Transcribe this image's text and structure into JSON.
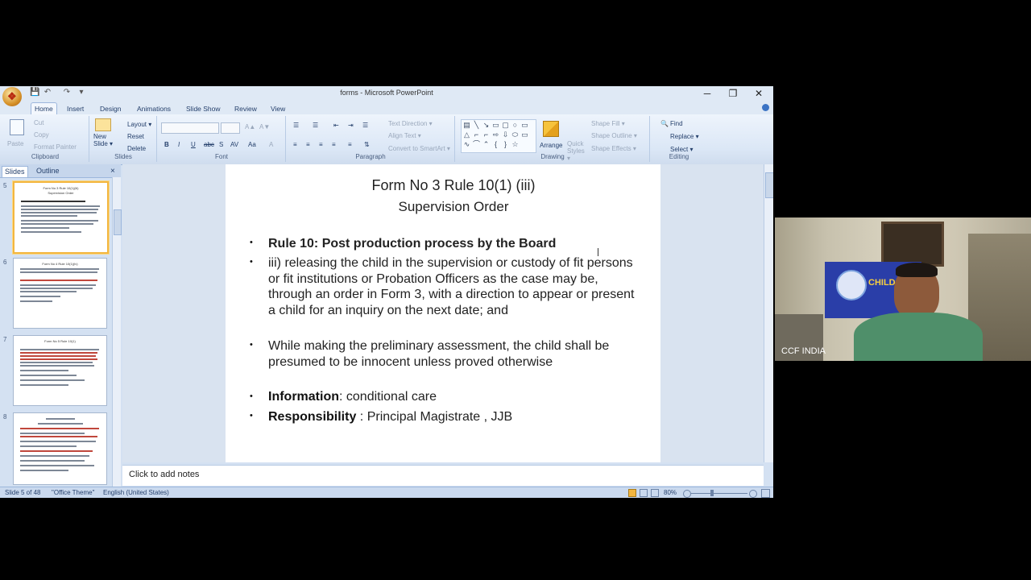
{
  "window": {
    "title": "forms - Microsoft PowerPoint",
    "minimize": "─",
    "restore": "❐",
    "close": "✕"
  },
  "qat": [
    "💾",
    "↶",
    "↷",
    "▾"
  ],
  "ribbon_tabs": [
    "Home",
    "Insert",
    "Design",
    "Animations",
    "Slide Show",
    "Review",
    "View"
  ],
  "ribbon": {
    "clipboard": {
      "paste": "Paste",
      "cut": "Cut",
      "copy": "Copy",
      "format_painter": "Format Painter",
      "name": "Clipboard"
    },
    "slides": {
      "new_slide": "New Slide ▾",
      "layout": "Layout ▾",
      "reset": "Reset",
      "delete": "Delete",
      "name": "Slides"
    },
    "font": {
      "name": "Font",
      "bold": "B",
      "italic": "I",
      "underline": "U",
      "strike": "abc",
      "shadow": "S",
      "spacing": "AV",
      "case": "Aa",
      "color": "A"
    },
    "paragraph": {
      "name": "Paragraph",
      "text_direction": "Text Direction ▾",
      "align_text": "Align Text ▾",
      "smartart": "Convert to SmartArt ▾"
    },
    "drawing": {
      "name": "Drawing",
      "arrange": "Arrange",
      "quick_styles": "Quick Styles ▾",
      "shape_fill": "Shape Fill ▾",
      "shape_outline": "Shape Outline ▾",
      "shape_effects": "Shape Effects ▾"
    },
    "editing": {
      "name": "Editing",
      "find": "Find",
      "replace": "Replace ▾",
      "select": "Select ▾"
    }
  },
  "pane": {
    "tabs": [
      "Slides",
      "Outline"
    ],
    "close": "×",
    "thumbnails": [
      {
        "num": "5",
        "title": "Form No 3 Rule 10(1)(iii)",
        "subtitle": "Supervision Order"
      },
      {
        "num": "6",
        "title": "Form No 4 Rule 10(1)(iv)",
        "subtitle": ""
      },
      {
        "num": "7",
        "title": "Form No 5 Rule 10(1)",
        "subtitle": ""
      },
      {
        "num": "8",
        "title": "",
        "subtitle": ""
      }
    ]
  },
  "slide": {
    "title_line1": "Form No 3   Rule 10(1) (iii)",
    "title_line2": "Supervision Order",
    "bullet_char": "•",
    "bullets": {
      "b1": "Rule 10: Post production process by the Board",
      "b2": "iii) releasing the child in the supervision or custody of fit persons or fit institutions or Probation Officers as the case may be, through an order in Form 3, with a direction to appear or present a child for an inquiry on the next date; and",
      "b3": "While making the preliminary assessment, the child shall be presumed to be innocent unless proved otherwise",
      "b4_label": "Information",
      "b4_value": ":  conditional care",
      "b5_label": "Responsibility",
      "b5_value": " : Principal Magistrate , JJB"
    }
  },
  "notes_placeholder": "Click to add notes",
  "status": {
    "slide": "Slide 5 of 48",
    "theme": "\"Office Theme\"",
    "language": "English (United States)",
    "zoom": "80%"
  },
  "webcam": {
    "label": "CCF INDIA",
    "banner_text": "CHILD CO"
  },
  "colors": {
    "ribbon_bg": "#dbe7f6",
    "selected_thumb": "#f3b63f",
    "banner": "#2a3ea8"
  }
}
